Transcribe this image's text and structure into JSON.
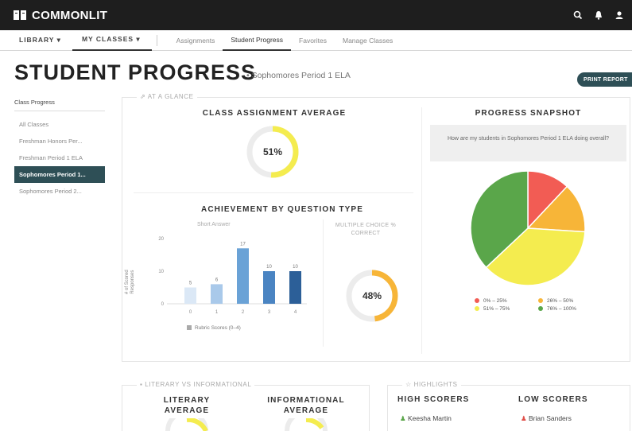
{
  "app": {
    "logo_text": "COMMONLIT"
  },
  "nav": {
    "library_label": "LIBRARY ▾",
    "my_classes_label": "MY CLASSES ▾",
    "subnav": [
      "Assignments",
      "Student Progress",
      "Favorites",
      "Manage Classes"
    ],
    "active_subnav": "Student Progress"
  },
  "header": {
    "title": "STUDENT PROGRESS",
    "subtitle": "• Sophomores Period 1 ELA",
    "print_button": "PRINT REPORT"
  },
  "sidebar": {
    "heading": "Class Progress",
    "items": [
      "All Classes",
      "Freshman Honors Per...",
      "Freshman Period 1 ELA",
      "Sophomores Period 1...",
      "Sophomores Period 2..."
    ],
    "active_index": 3
  },
  "glance": {
    "legend": "AT A GLANCE",
    "class_avg_title": "CLASS ASSIGNMENT AVERAGE",
    "class_avg_value": "51%",
    "class_avg_fraction": 0.51,
    "achievement_title": "ACHIEVEMENT BY QUESTION TYPE",
    "short_answer_label": "Short Answer",
    "mc_label_line1": "MULTIPLE CHOICE %",
    "mc_label_line2": "CORRECT",
    "mc_value": "48%",
    "mc_fraction": 0.48,
    "y_axis_label_line1": "# of Scored",
    "y_axis_label_line2": "Responses",
    "legend_label": "Rubric Scores (0–4)"
  },
  "snapshot": {
    "title": "PROGRESS SNAPSHOT",
    "question": "How are my students in Sophomores Period 1 ELA doing overall?",
    "legend": [
      {
        "label": "0% – 25%",
        "color": "#f25c54"
      },
      {
        "label": "26% – 50%",
        "color": "#f7b538"
      },
      {
        "label": "51% – 75%",
        "color": "#f4ec4f"
      },
      {
        "label": "76% – 100%",
        "color": "#5aa64a"
      }
    ]
  },
  "chart_data": [
    {
      "type": "bar",
      "title": "ACHIEVEMENT BY QUESTION TYPE",
      "xlabel": "",
      "ylabel": "# of Scored Responses",
      "categories": [
        "0",
        "1",
        "2",
        "3",
        "4"
      ],
      "values": [
        5,
        6,
        17,
        10,
        10
      ],
      "yticks": [
        0,
        10,
        20
      ],
      "ylim": [
        0,
        20
      ],
      "colors": [
        "#dbe8f6",
        "#a9c9ea",
        "#6aa2d6",
        "#4a84c2",
        "#2c5f98"
      ],
      "legend": [
        "Rubric Scores (0–4)"
      ]
    },
    {
      "type": "pie",
      "title": "PROGRESS SNAPSHOT",
      "categories": [
        "0% – 25%",
        "26% – 50%",
        "51% – 75%",
        "76% – 100%"
      ],
      "values": [
        12,
        14,
        37,
        37
      ],
      "colors": [
        "#f25c54",
        "#f7b538",
        "#f4ec4f",
        "#5aa64a"
      ]
    }
  ],
  "lower": {
    "lit_legend": "LITERARY VS INFORMATIONAL",
    "literary_line1": "LITERARY",
    "literary_line2": "AVERAGE",
    "informational_line1": "INFORMATIONAL",
    "informational_line2": "AVERAGE",
    "highlights_legend": "HIGHLIGHTS",
    "high_scorers": "HIGH SCORERS",
    "low_scorers": "LOW SCORERS",
    "high_name": "Keesha Martin",
    "low_name": "Brian Sanders"
  },
  "colors": {
    "accent": "#2e4f56",
    "gauge_fill": "#f4ec4f",
    "gauge_mc": "#f7b538",
    "high_icon": "#5aa64a",
    "low_icon": "#e0504a"
  }
}
